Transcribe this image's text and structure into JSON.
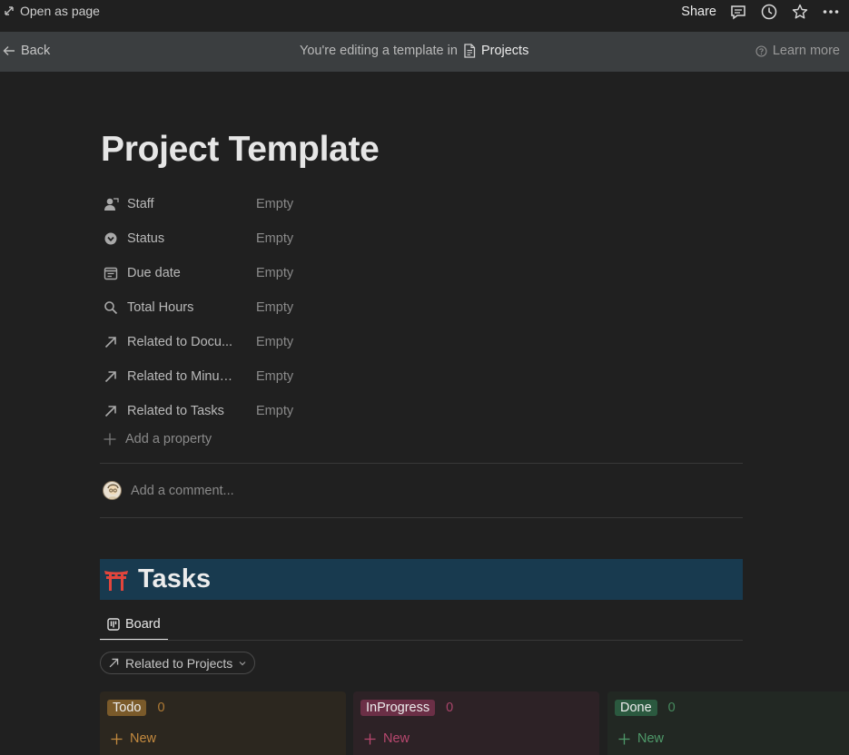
{
  "topbar": {
    "open_as_page": "Open as page",
    "share": "Share"
  },
  "banner": {
    "back": "Back",
    "editing_text": "You're editing a template in",
    "project": "Projects",
    "learn_more": "Learn more"
  },
  "page": {
    "title": "Project Template"
  },
  "properties": [
    {
      "name": "Staff",
      "value": "Empty",
      "icon": "person-icon"
    },
    {
      "name": "Status",
      "value": "Empty",
      "icon": "status-icon"
    },
    {
      "name": "Due date",
      "value": "Empty",
      "icon": "calendar-icon"
    },
    {
      "name": "Total Hours",
      "value": "Empty",
      "icon": "search-icon"
    },
    {
      "name": "Related to Docu...",
      "value": "Empty",
      "icon": "relation-arrow-icon"
    },
    {
      "name": "Related to Minutes",
      "value": "Empty",
      "icon": "relation-arrow-icon"
    },
    {
      "name": "Related to Tasks",
      "value": "Empty",
      "icon": "relation-arrow-icon"
    }
  ],
  "add_property": "Add a property",
  "comment": {
    "placeholder": "Add a comment..."
  },
  "tasks": {
    "emoji": "⛩",
    "title": "Tasks",
    "tab": "Board",
    "filter": "Related to Projects",
    "columns": [
      {
        "label": "Todo",
        "count": "0",
        "new": "New",
        "tag_color": "#7a5a2a",
        "text_color": "#c48a3f"
      },
      {
        "label": "InProgress",
        "count": "0",
        "new": "New",
        "tag_color": "#6b2f46",
        "text_color": "#b8486f"
      },
      {
        "label": "Done",
        "count": "0",
        "new": "New",
        "tag_color": "#2b593f",
        "text_color": "#4f9a6a"
      }
    ]
  }
}
